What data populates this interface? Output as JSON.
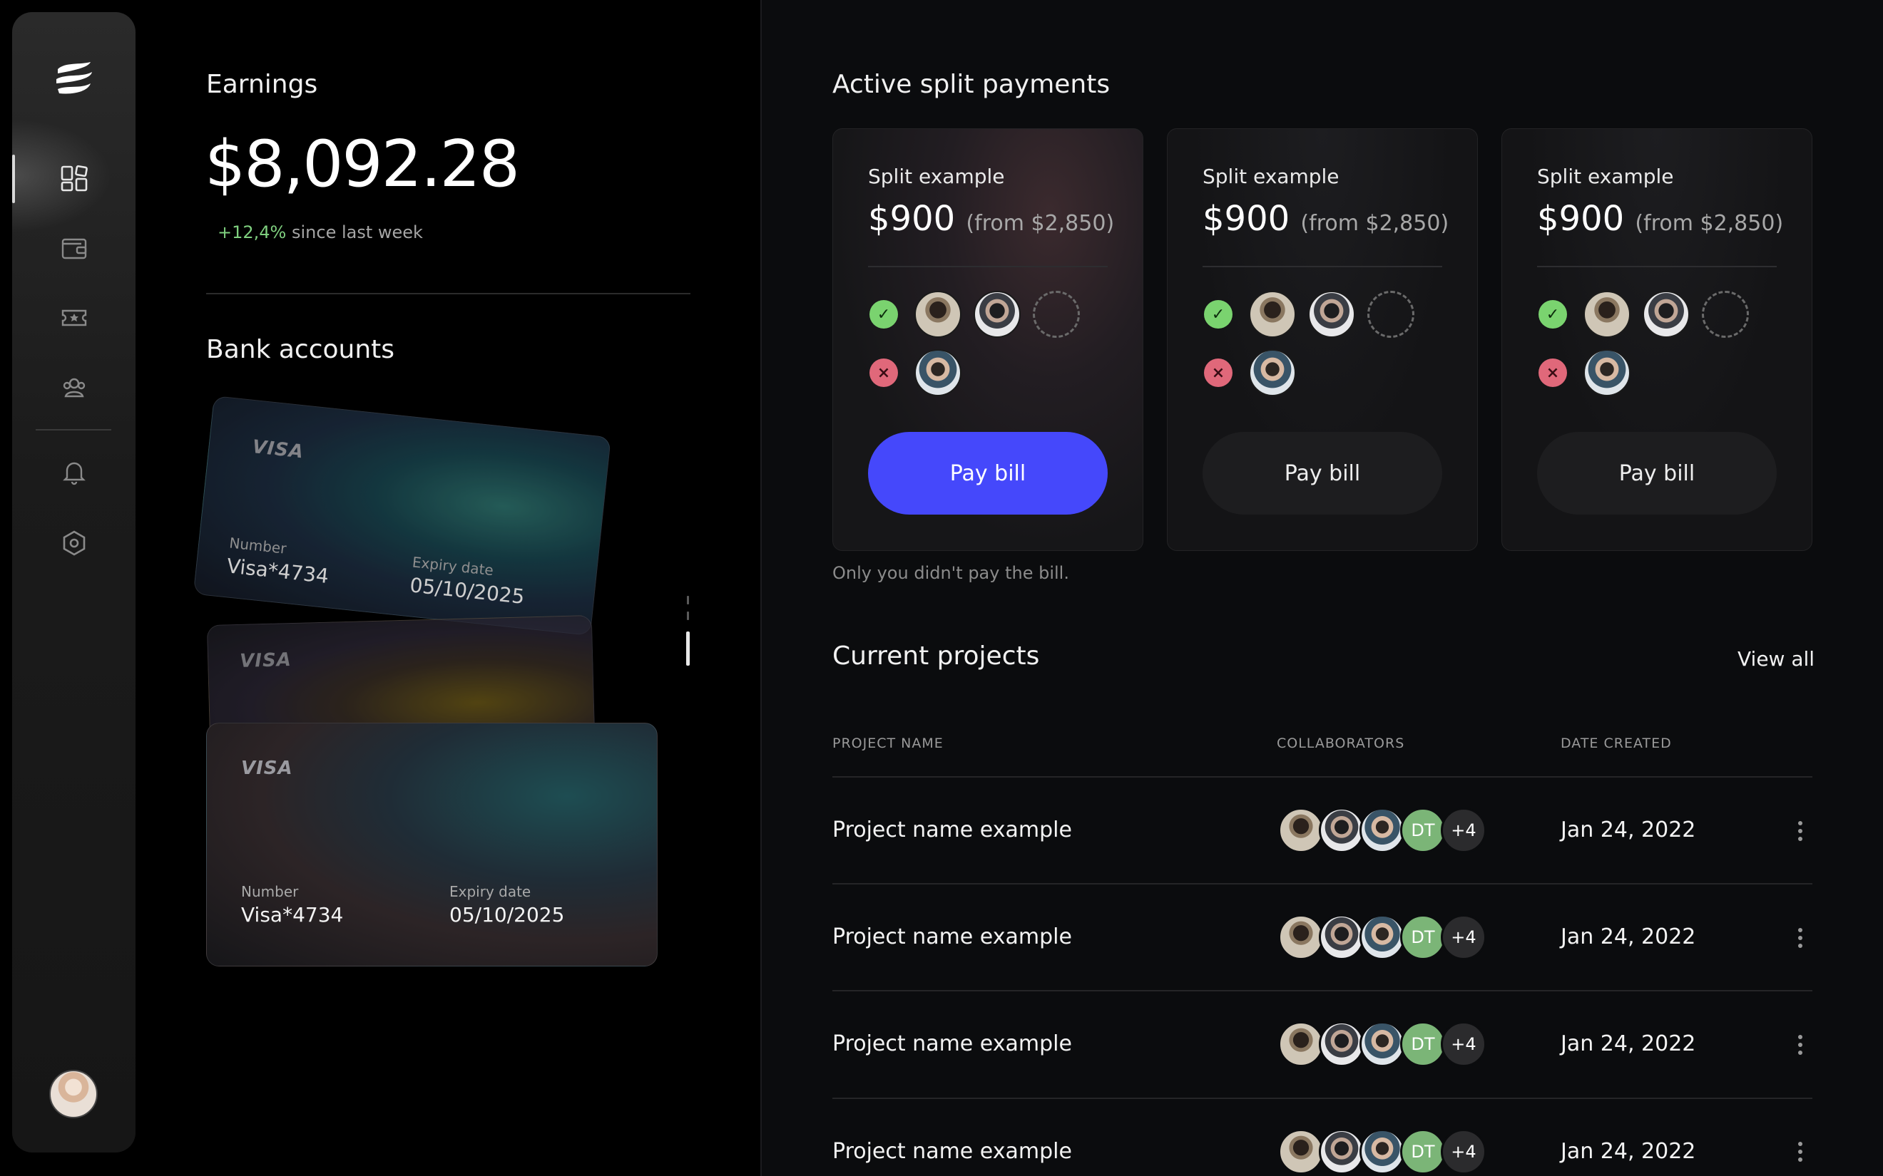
{
  "sidebar": {
    "logo": "brand-logo-icon",
    "items": [
      {
        "icon": "dashboard-icon",
        "active": true
      },
      {
        "icon": "wallet-icon",
        "active": false
      },
      {
        "icon": "ticket-icon",
        "active": false
      },
      {
        "icon": "users-icon",
        "active": false
      },
      {
        "icon": "bell-icon",
        "active": false
      },
      {
        "icon": "settings-icon",
        "active": false
      }
    ],
    "avatar": "user-avatar"
  },
  "earnings": {
    "title": "Earnings",
    "amount": "$8,092.28",
    "change": "+12,4%",
    "change_suffix": " since last week"
  },
  "bank": {
    "title": "Bank accounts",
    "cards": [
      {
        "brand": "VISA",
        "number_label": "Number",
        "number": "Visa*4734",
        "expiry_label": "Expiry date",
        "expiry": "05/10/2025"
      },
      {
        "brand": "VISA"
      },
      {
        "brand": "VISA",
        "number_label": "Number",
        "number": "Visa*4734",
        "expiry_label": "Expiry date",
        "expiry": "05/10/2025"
      }
    ]
  },
  "split": {
    "title": "Active split payments",
    "note": "Only you didn't pay the bill.",
    "cards": [
      {
        "label": "Split example",
        "amount": "$900",
        "from": "(from $2,850)",
        "button": "Pay bill"
      },
      {
        "label": "Split example",
        "amount": "$900",
        "from": "(from $2,850)",
        "button": "Pay bill"
      },
      {
        "label": "Split example",
        "amount": "$900",
        "from": "(from $2,850)",
        "button": "Pay bill"
      }
    ]
  },
  "projects": {
    "title": "Current projects",
    "view_all": "View all",
    "columns": [
      "PROJECT NAME",
      "COLLABORATORS",
      "DATE CREATED"
    ],
    "rows": [
      {
        "name": "Project name example",
        "initials": "DT",
        "more": "+4",
        "date": "Jan 24, 2022"
      },
      {
        "name": "Project name example",
        "initials": "DT",
        "more": "+4",
        "date": "Jan 24, 2022"
      },
      {
        "name": "Project name example",
        "initials": "DT",
        "more": "+4",
        "date": "Jan 24, 2022"
      },
      {
        "name": "Project name example",
        "initials": "DT",
        "more": "+4",
        "date": "Jan 24, 2022"
      }
    ]
  },
  "colors": {
    "accent": "#4548fb",
    "positive": "#7fd07f",
    "paid": "#7ad36f",
    "unpaid": "#e0687a",
    "initials_bg": "#7bb577"
  }
}
